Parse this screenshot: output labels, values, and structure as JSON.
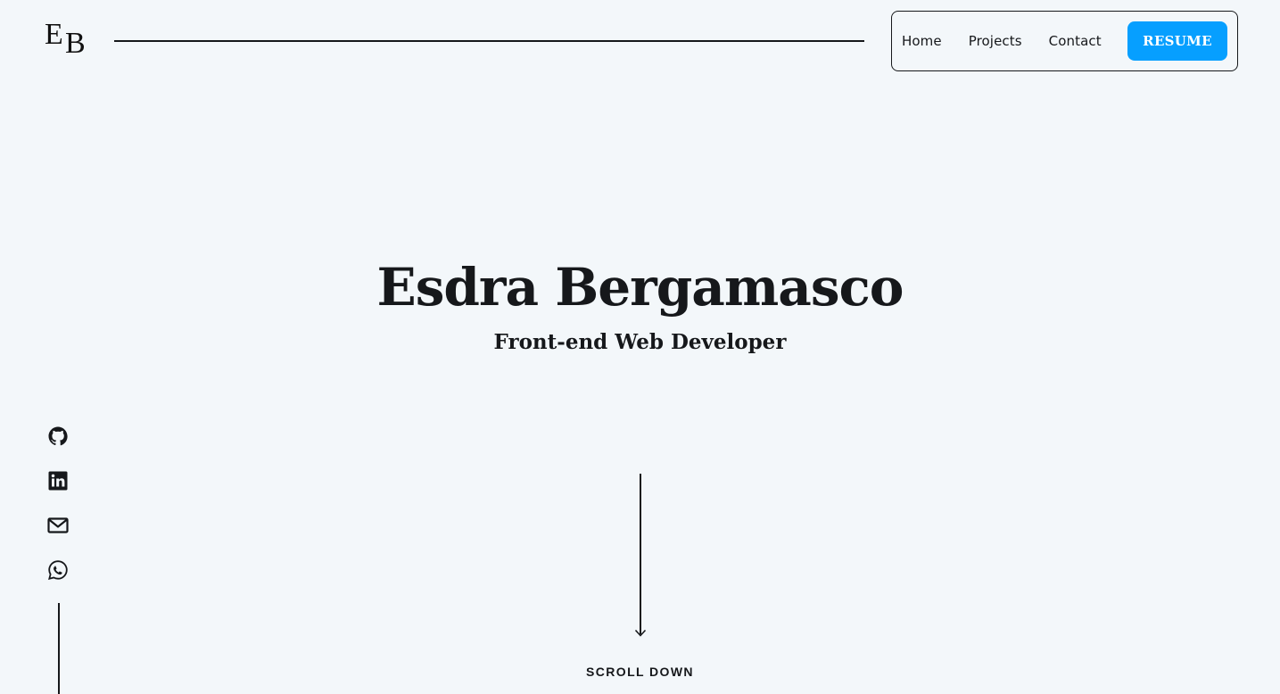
{
  "header": {
    "logo_letter_1": "E",
    "logo_letter_2": "B",
    "nav": {
      "home": "Home",
      "projects": "Projects",
      "contact": "Contact",
      "resume": "RESUME"
    }
  },
  "hero": {
    "name": "Esdra Bergamasco",
    "role": "Front-end Web Developer"
  },
  "social": {
    "icons": [
      "github-icon",
      "linkedin-icon",
      "mail-icon",
      "whatsapp-icon"
    ]
  },
  "scroll": {
    "label": "SCROLL DOWN"
  },
  "colors": {
    "background": "#f3f7fa",
    "text": "#16181b",
    "accent": "#069fff"
  }
}
